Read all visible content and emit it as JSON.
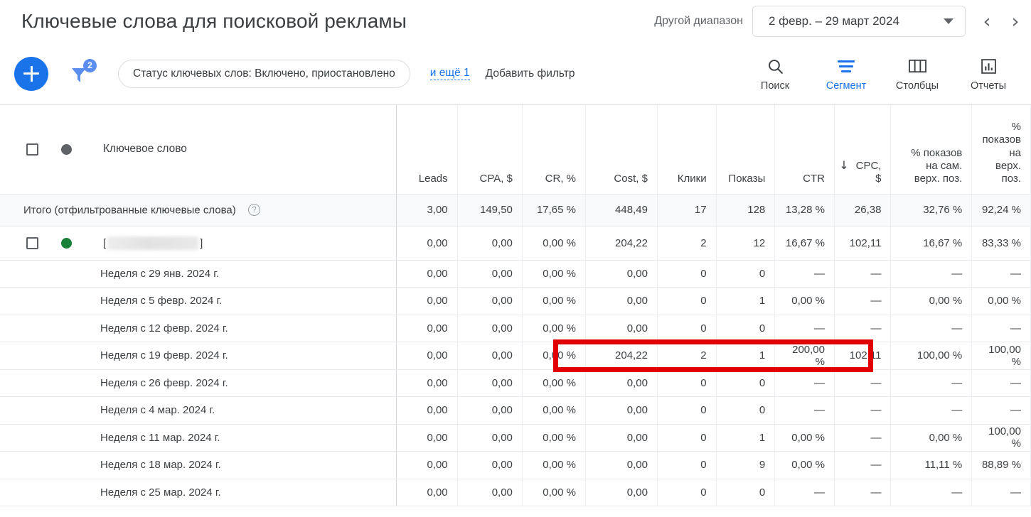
{
  "header": {
    "title": "Ключевые слова для поисковой рекламы",
    "range_label": "Другой диапазон",
    "date_range": "2 февр. – 29 март 2024",
    "prev_arrow": "‹",
    "next_arrow": "›"
  },
  "toolbar": {
    "add_button": "+",
    "filter_badge": "2",
    "filter_chip": "Статус ключевых слов: Включено, приостановлено",
    "more_link": "и ещё 1",
    "add_filter": "Добавить фильтр",
    "actions": [
      {
        "label": "Поиск",
        "icon": "search-icon",
        "active": false
      },
      {
        "label": "Сегмент",
        "icon": "segment-icon",
        "active": true
      },
      {
        "label": "Столбцы",
        "icon": "columns-icon",
        "active": false
      },
      {
        "label": "Отчеты",
        "icon": "reports-icon",
        "active": false
      }
    ]
  },
  "table": {
    "columns": [
      "Ключевое слово",
      "Leads",
      "CPA, $",
      "CR, %",
      "Cost, $",
      "Клики",
      "Показы",
      "CTR",
      "CPC, $",
      "% показов на сам. верх. поз.",
      "% показов на верх. поз."
    ],
    "sort_column": "CPC, $",
    "sort_arrow": "↓",
    "totals": {
      "label": "Итого (отфильтрованные ключевые слова)",
      "help": "?",
      "values": [
        "3,00",
        "149,50",
        "17,65 %",
        "448,49",
        "17",
        "128",
        "13,28 %",
        "26,38",
        "32,76 %",
        "92,24 %"
      ]
    },
    "keyword_row": {
      "status": "green",
      "prefix": "[",
      "suffix": "]",
      "values": [
        "0,00",
        "0,00",
        "0,00 %",
        "204,22",
        "2",
        "12",
        "16,67 %",
        "102,11",
        "16,67 %",
        "83,33 %"
      ]
    },
    "week_rows": [
      {
        "label": "Неделя с 29 янв. 2024 г.",
        "values": [
          "0,00",
          "0,00",
          "0,00 %",
          "0,00",
          "0",
          "0",
          "—",
          "—",
          "—",
          "—"
        ]
      },
      {
        "label": "Неделя с 5 февр. 2024 г.",
        "values": [
          "0,00",
          "0,00",
          "0,00 %",
          "0,00",
          "0",
          "1",
          "0,00 %",
          "—",
          "0,00 %",
          "0,00 %"
        ]
      },
      {
        "label": "Неделя с 12 февр. 2024 г.",
        "values": [
          "0,00",
          "0,00",
          "0,00 %",
          "0,00",
          "0",
          "0",
          "—",
          "—",
          "—",
          "—"
        ]
      },
      {
        "label": "Неделя с 19 февр. 2024 г.",
        "values": [
          "0,00",
          "0,00",
          "0,00 %",
          "204,22",
          "2",
          "1",
          "200,00 %",
          "102,11",
          "100,00 %",
          "100,00 %"
        ]
      },
      {
        "label": "Неделя с 26 февр. 2024 г.",
        "values": [
          "0,00",
          "0,00",
          "0,00 %",
          "0,00",
          "0",
          "0",
          "—",
          "—",
          "—",
          "—"
        ]
      },
      {
        "label": "Неделя с 4 мар. 2024 г.",
        "values": [
          "0,00",
          "0,00",
          "0,00 %",
          "0,00",
          "0",
          "0",
          "—",
          "—",
          "—",
          "—"
        ]
      },
      {
        "label": "Неделя с 11 мар. 2024 г.",
        "values": [
          "0,00",
          "0,00",
          "0,00 %",
          "0,00",
          "0",
          "1",
          "0,00 %",
          "—",
          "0,00 %",
          "100,00 %"
        ]
      },
      {
        "label": "Неделя с 18 мар. 2024 г.",
        "values": [
          "0,00",
          "0,00",
          "0,00 %",
          "0,00",
          "0",
          "9",
          "0,00 %",
          "—",
          "11,11 %",
          "88,89 %"
        ]
      },
      {
        "label": "Неделя с 25 мар. 2024 г.",
        "values": [
          "0,00",
          "0,00",
          "0,00 %",
          "0,00",
          "0",
          "0",
          "—",
          "—",
          "—",
          "—"
        ]
      }
    ]
  },
  "annotation": {
    "color": "#e00000",
    "highlight_row": "Неделя с 19 февр. 2024 г.",
    "highlight_columns": [
      "Cost, $",
      "Клики",
      "Показы",
      "CTR",
      "CPC, $"
    ]
  },
  "colors": {
    "accent": "#1a73e8",
    "status_active": "#188038",
    "status_header": "#5f6368",
    "text": "#3c4043",
    "annotation_red": "#e00000"
  }
}
